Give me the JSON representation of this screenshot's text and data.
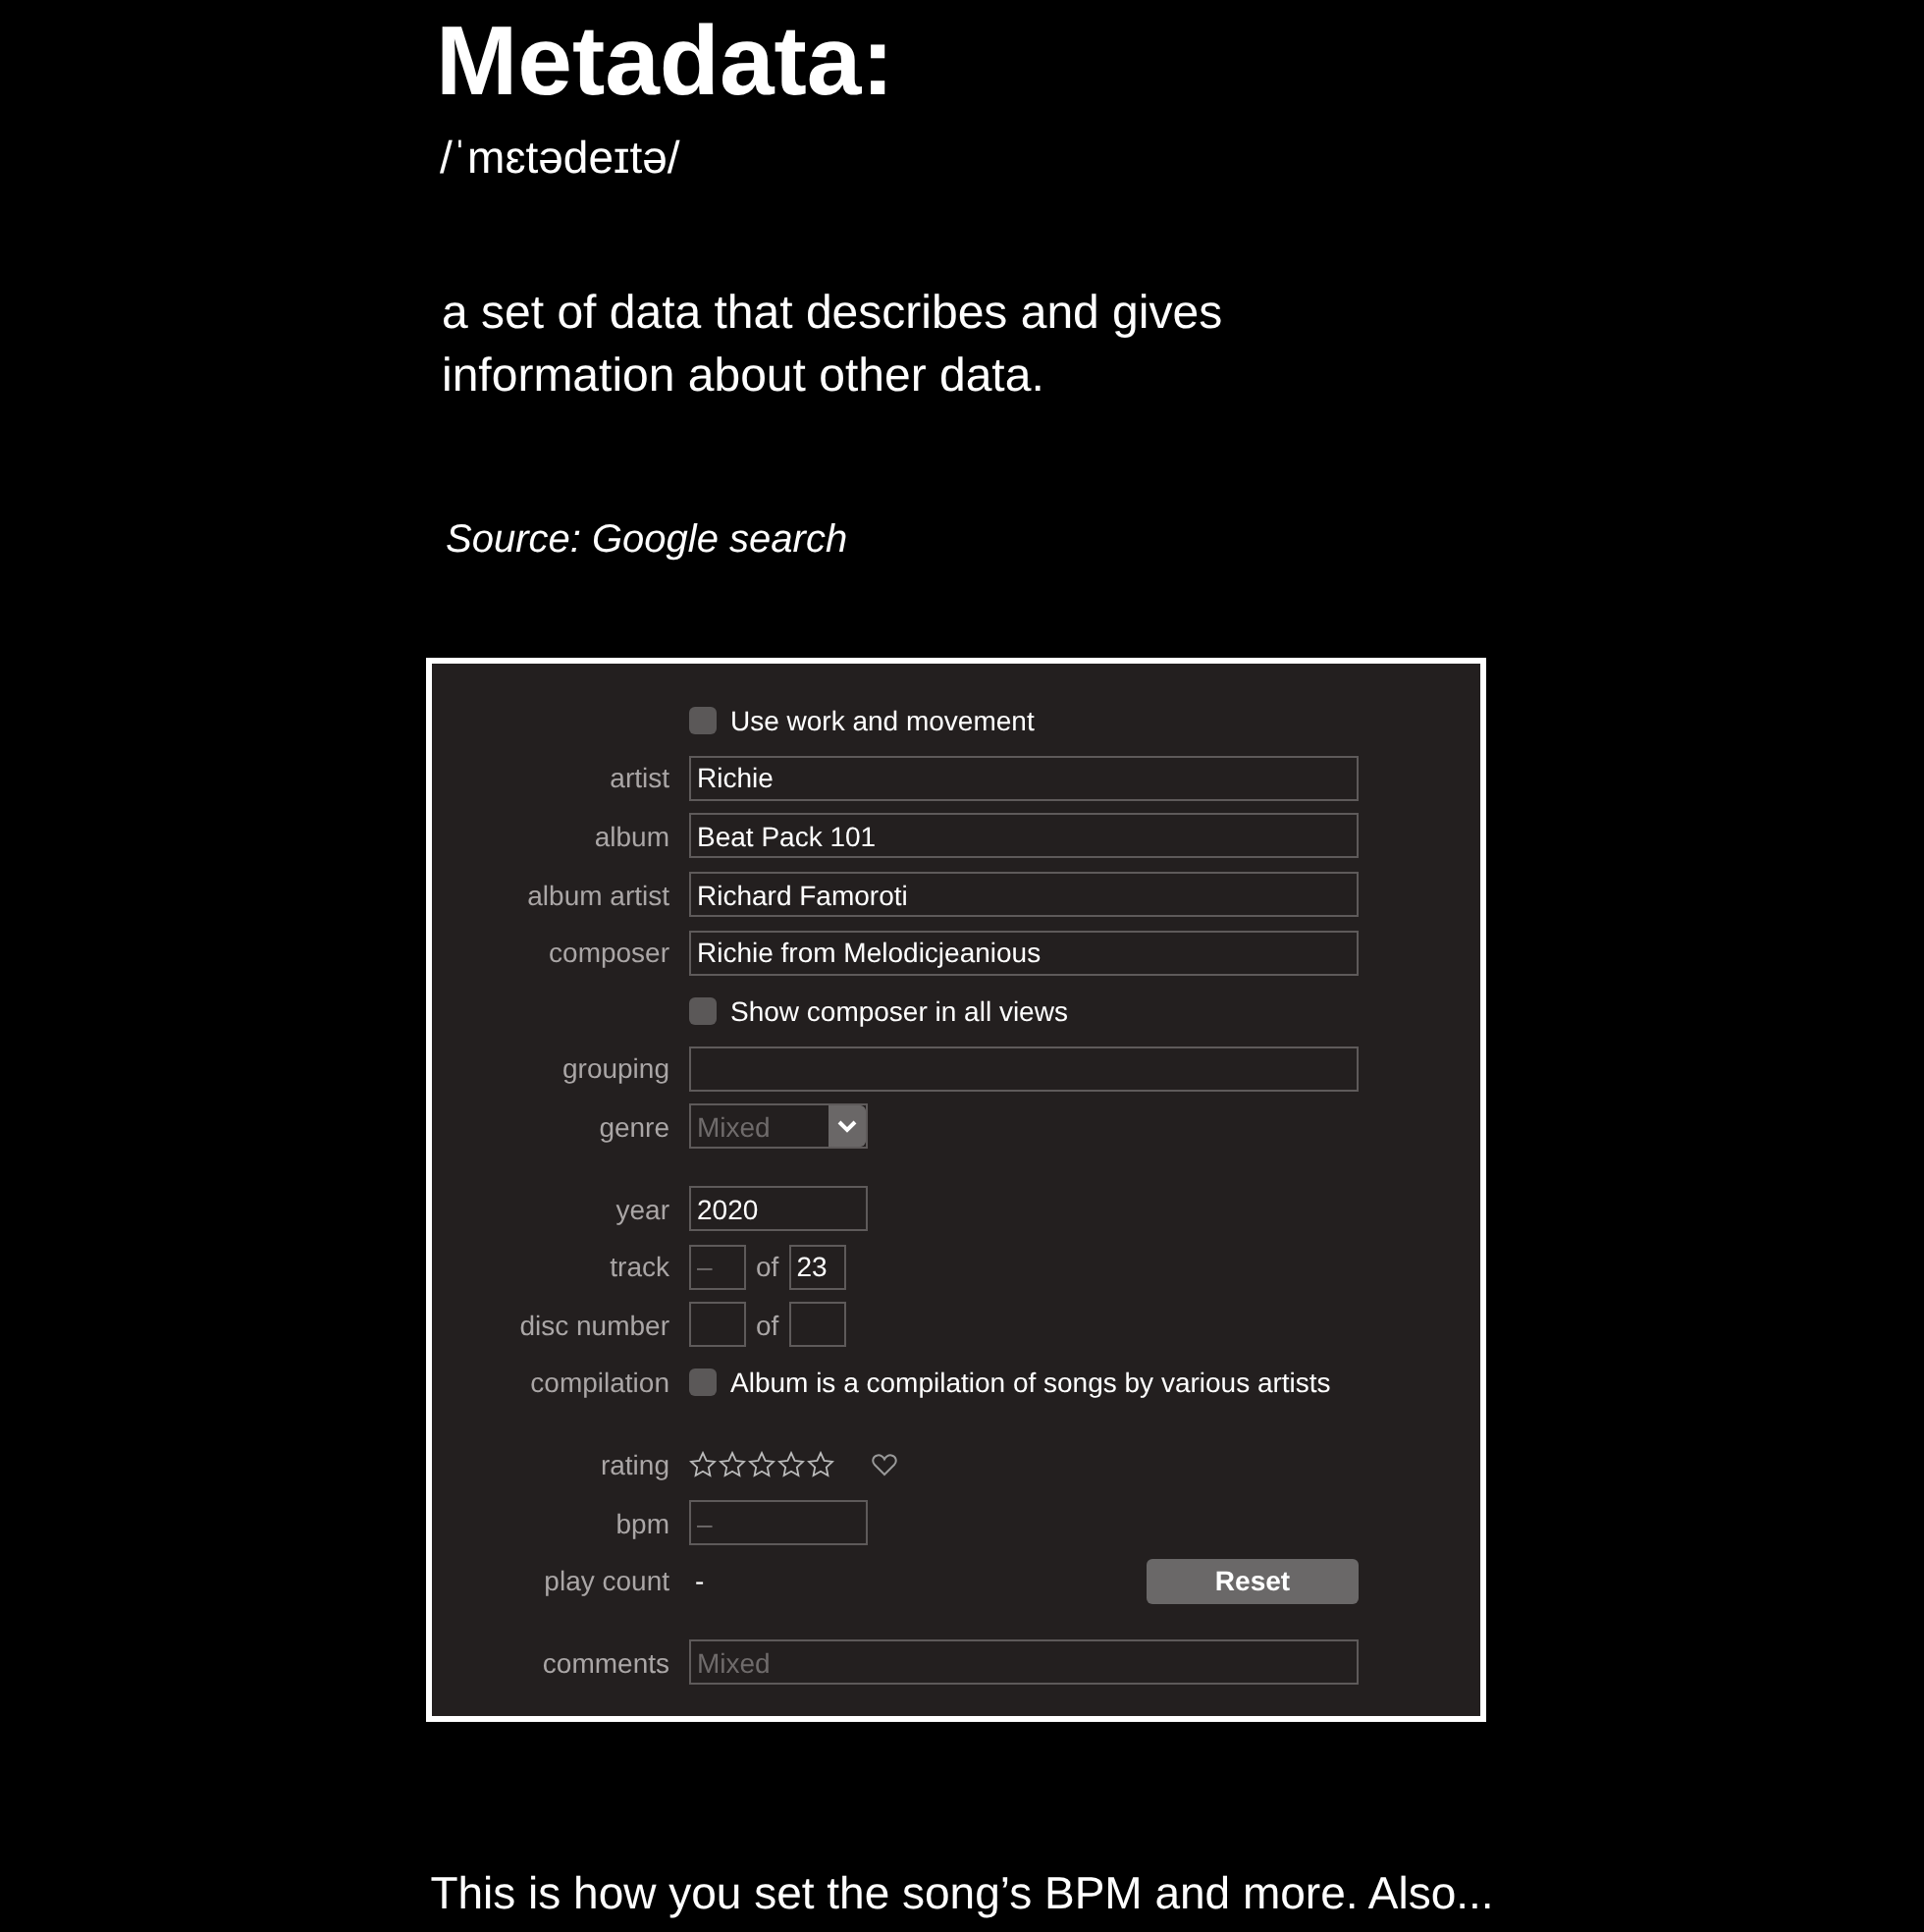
{
  "title": "Metadata:",
  "pronunciation": "/ˈmɛtədeɪtə/",
  "definition": "a set of data that describes and gives information about other data.",
  "source": "Source: Google search",
  "info_panel": {
    "sections": [
      [
        {
          "kind": "checkbox",
          "text": "Use work and movement",
          "checked": false
        },
        {
          "kind": "text",
          "label": "artist",
          "value": "Richie"
        },
        {
          "kind": "text",
          "label": "album",
          "value": "Beat Pack 101"
        },
        {
          "kind": "text",
          "label": "album artist",
          "value": "Richard Famoroti"
        },
        {
          "kind": "text",
          "label": "composer",
          "value": "Richie from Melodicjeanious"
        },
        {
          "kind": "checkbox",
          "text": "Show composer in all views",
          "checked": false
        },
        {
          "kind": "text",
          "label": "grouping"
        },
        {
          "kind": "select",
          "label": "genre",
          "placeholder": "Mixed"
        }
      ],
      [
        {
          "kind": "short",
          "label": "year",
          "value": "2020"
        },
        {
          "kind": "pair",
          "label": "track",
          "placeholder": "–",
          "of": "of",
          "total": "23"
        },
        {
          "kind": "pair",
          "label": "disc number",
          "of": "of"
        },
        {
          "kind": "checkbox",
          "label": "compilation",
          "text": "Album is a compilation of songs by various artists",
          "checked": false
        }
      ],
      [
        {
          "kind": "rating",
          "label": "rating",
          "stars": 0,
          "loved": false
        },
        {
          "kind": "short",
          "label": "bpm",
          "placeholder": "–"
        },
        {
          "kind": "playcount",
          "label": "play count",
          "count": "-",
          "button": "Reset"
        }
      ],
      [
        {
          "kind": "text",
          "label": "comments",
          "placeholder": "Mixed"
        }
      ]
    ]
  },
  "caption": "This is how you set the song’s BPM and more. Also..."
}
